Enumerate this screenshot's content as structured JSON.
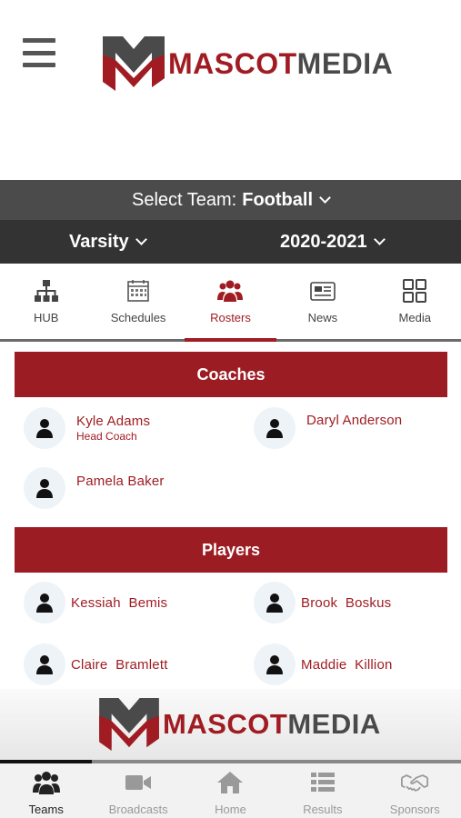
{
  "header": {
    "menu_icon": "hamburger-icon",
    "logo_bold": "MASCOT",
    "logo_light": "MEDIA",
    "logo_colors": {
      "red": "#a01c22",
      "gray": "#4a4a4a"
    }
  },
  "team_selector": {
    "label": "Select Team:",
    "value": "Football",
    "level": "Varsity",
    "season": "2020-2021"
  },
  "nav_tabs": [
    {
      "label": "HUB",
      "icon": "hierarchy-icon",
      "active": false
    },
    {
      "label": "Schedules",
      "icon": "calendar-icon",
      "active": false
    },
    {
      "label": "Rosters",
      "icon": "people-icon",
      "active": true
    },
    {
      "label": "News",
      "icon": "newspaper-icon",
      "active": false
    },
    {
      "label": "Media",
      "icon": "grid-icon",
      "active": false
    }
  ],
  "coaches": {
    "title": "Coaches",
    "people": [
      {
        "name": "Kyle Adams",
        "role": "Head Coach"
      },
      {
        "name": "Daryl Anderson"
      },
      {
        "name": "Pamela Baker"
      }
    ]
  },
  "players": {
    "title": "Players",
    "people": [
      {
        "name": "Kessiah  Bemis"
      },
      {
        "name": "Brook  Boskus"
      },
      {
        "name": "Claire  Bramlett"
      },
      {
        "name": "Maddie  Killion"
      }
    ]
  },
  "footer_logo": {
    "bold": "MASCOT",
    "light": "MEDIA"
  },
  "ad_progress": 0.2,
  "bottom_tabs": [
    {
      "label": "Teams",
      "icon": "team-icon",
      "active": true
    },
    {
      "label": "Broadcasts",
      "icon": "video-camera-icon",
      "active": false
    },
    {
      "label": "Home",
      "icon": "home-icon",
      "active": false
    },
    {
      "label": "Results",
      "icon": "list-icon",
      "active": false
    },
    {
      "label": "Sponsors",
      "icon": "handshake-icon",
      "active": false
    }
  ],
  "accent_color": "#9b1c22"
}
